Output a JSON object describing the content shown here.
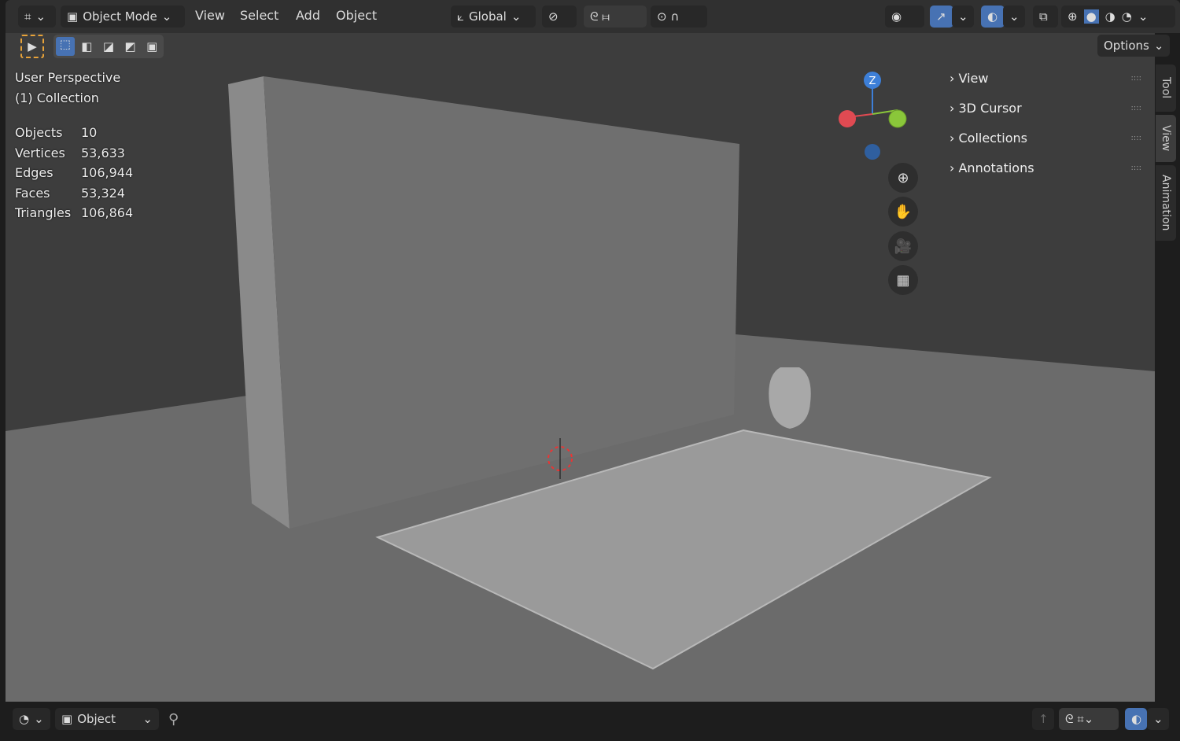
{
  "header": {
    "mode": "Object Mode",
    "menus": [
      "View",
      "Select",
      "Add",
      "Object"
    ],
    "orientation": "Global",
    "options": "Options"
  },
  "overlay": {
    "view_name": "User Perspective",
    "collection": "(1) Collection",
    "stats": [
      {
        "label": "Objects",
        "value": "10"
      },
      {
        "label": "Vertices",
        "value": "53,633"
      },
      {
        "label": "Edges",
        "value": "106,944"
      },
      {
        "label": "Faces",
        "value": "53,324"
      },
      {
        "label": "Triangles",
        "value": "106,864"
      }
    ]
  },
  "gizmo": {
    "z_label": "Z"
  },
  "npanel": {
    "items": [
      "View",
      "3D Cursor",
      "Collections",
      "Annotations"
    ]
  },
  "side_tabs": [
    "Tool",
    "View",
    "Animation"
  ],
  "footer": {
    "editor": "Object"
  },
  "colors": {
    "accent": "#4772b3",
    "x_axis": "#e04a52",
    "y_axis": "#8ac73a",
    "z_axis": "#3d7fd8"
  }
}
